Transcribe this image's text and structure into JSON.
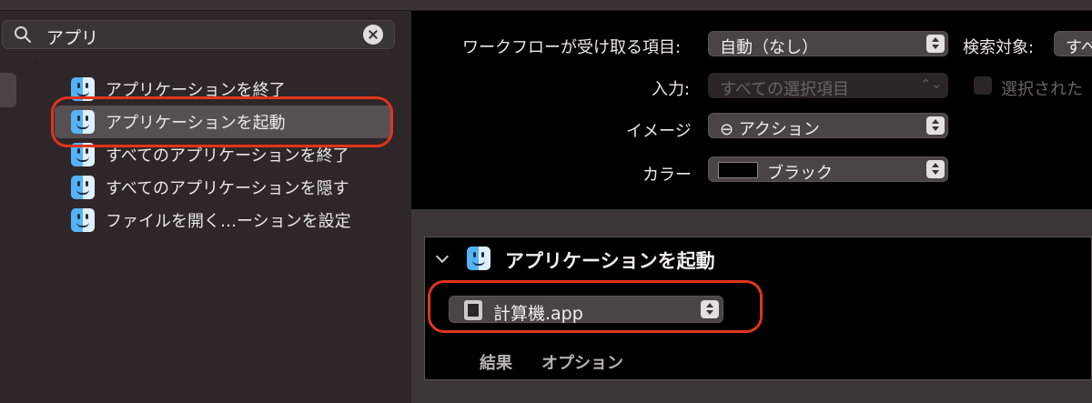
{
  "search": {
    "query": "アプリ"
  },
  "actions": [
    {
      "label": "アプリケーションを終了"
    },
    {
      "label": "アプリケーションを起動"
    },
    {
      "label": "すべてのアプリケーションを終了"
    },
    {
      "label": "すべてのアプリケーションを隠す"
    },
    {
      "label": "ファイルを開く…ーションを設定"
    }
  ],
  "workflow": {
    "receives_label": "ワークフローが受け取る項目:",
    "receives_value": "自動（なし）",
    "search_target_label": "検索対象:",
    "search_target_value": "すべ",
    "input_label": "入力:",
    "input_value": "すべての選択項目",
    "selected_checkbox_label": "選択された",
    "image_label": "イメージ",
    "image_value": "⊖ アクション",
    "color_label": "カラー",
    "color_value": "ブラック"
  },
  "action_card": {
    "title": "アプリケーションを起動",
    "app_value": "計算機.app",
    "tabs": [
      "結果",
      "オプション"
    ]
  }
}
